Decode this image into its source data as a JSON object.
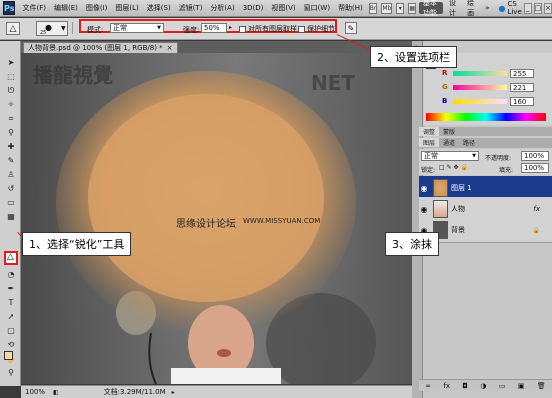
{
  "menubar": {
    "logo": "Ps",
    "items": [
      "文件(F)",
      "编辑(E)",
      "图像(I)",
      "图层(L)",
      "选择(S)",
      "滤镜(T)",
      "分析(A)",
      "3D(D)",
      "视图(V)",
      "窗口(W)",
      "帮助(H)"
    ],
    "workspaces": [
      "基本功能",
      "设计",
      "绘画"
    ],
    "workspace_more": "»",
    "cs_live": "CS Live"
  },
  "options": {
    "size": "25",
    "mode_label": "模式:",
    "mode_value": "正常",
    "strength_label": "强度:",
    "strength_value": "50%",
    "sample_all_label": "对所有图层取样",
    "protect_detail_label": "保护细节"
  },
  "document": {
    "tab_title": "人物背景.psd @ 100% (图层 1, RGB/8) *",
    "zoom": "100%",
    "doc_size": "文档:3.29M/11.0M"
  },
  "canvas_text": {
    "watermark_left": "播龍視覺",
    "watermark_right": "NET",
    "forum_cn": "思缘设计论坛",
    "forum_url": "WWW.MISSYUAN.COM"
  },
  "color_panel": {
    "r": "255",
    "g": "221",
    "b": "160",
    "tabs": [
      "调整",
      "蒙版"
    ]
  },
  "layers_panel": {
    "tabs": [
      "图层",
      "通道",
      "路径"
    ],
    "blend_mode": "正常",
    "opacity_label": "不透明度:",
    "opacity_value": "100%",
    "lock_label": "锁定:",
    "fill_label": "填充:",
    "fill_value": "100%",
    "layers": [
      {
        "name": "图层 1",
        "selected": true
      },
      {
        "name": "人物",
        "fx": "fx"
      },
      {
        "name": "背景"
      }
    ]
  },
  "callouts": {
    "step1": "1、选择“锐化”工具",
    "step2": "2、设置选项栏",
    "step3": "3、涂抹"
  },
  "colors": {
    "accent_red": "#e21b1b",
    "selected_layer": "#1c3a8c",
    "hair": "#d9a066"
  }
}
